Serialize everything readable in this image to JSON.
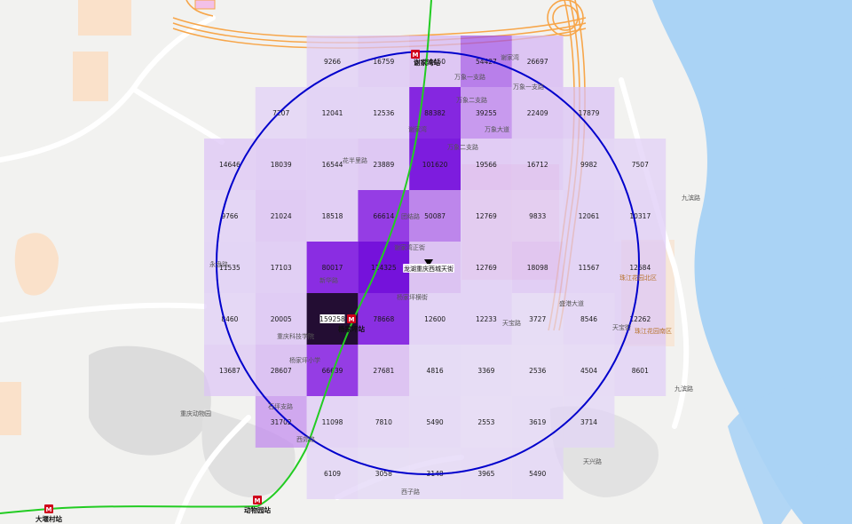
{
  "grid": {
    "rows": [
      {
        "cells": [
          null,
          null,
          9266,
          16759,
          24450,
          54427,
          26697,
          null,
          null,
          null
        ]
      },
      {
        "cells": [
          null,
          7207,
          12041,
          12536,
          88382,
          39255,
          22409,
          17879,
          null,
          null
        ]
      },
      {
        "cells": [
          14646,
          18039,
          16544,
          23889,
          101620,
          19566,
          16712,
          9982,
          7507,
          null
        ]
      },
      {
        "cells": [
          9766,
          21024,
          18518,
          66614,
          50087,
          12769,
          9833,
          12061,
          10317,
          null
        ]
      },
      {
        "cells": [
          11535,
          17103,
          80017,
          114325,
          29216,
          12769,
          18098,
          11567,
          12684,
          null
        ]
      },
      {
        "cells": [
          8460,
          20005,
          159258,
          78668,
          12600,
          12233,
          3727,
          8546,
          12262,
          null
        ]
      },
      {
        "cells": [
          13687,
          28607,
          66639,
          27681,
          4816,
          3369,
          2536,
          4504,
          8601,
          null
        ]
      },
      {
        "cells": [
          null,
          31702,
          11098,
          7810,
          5490,
          2553,
          3619,
          3714,
          null,
          null
        ]
      },
      {
        "cells": [
          null,
          null,
          6109,
          3058,
          3148,
          3965,
          5490,
          null,
          null,
          null
        ]
      }
    ],
    "colors": {
      "min": "#e3d6f7",
      "low": "#c58ef0",
      "mid": "#8a2be2",
      "high": "#6a00d8",
      "max": "#150025"
    }
  },
  "circle": {
    "color": "#0000cc"
  },
  "metro_line": {
    "color": "#22cc22"
  },
  "stations": [
    {
      "name": "谢家湾站",
      "icon": "metro-icon"
    },
    {
      "name": "杨家坪站",
      "icon": "metro-icon"
    },
    {
      "name": "动物园站",
      "icon": "metro-icon"
    },
    {
      "name": "大堰村站",
      "icon": "metro-icon"
    }
  ],
  "center": {
    "name": "龙湖重庆西城天街",
    "icon": "triangle-marker-icon"
  },
  "places": [
    "万象一支路",
    "万象一支路",
    "万象二支路",
    "万象大道",
    "万象二支路",
    "谢家湾",
    "谢家湾",
    "花半里路",
    "团结路",
    "谢家湾正街",
    "新华路",
    "杨家坪横街",
    "重庆科技学院",
    "杨家坪小学",
    "石坪支路",
    "西郊路",
    "重庆动物园",
    "天宝路",
    "盛港大道",
    "天宝街",
    "九滨路",
    "九滨路",
    "天兴路",
    "西子路",
    "珠江花园北区",
    "珠江花园南区"
  ]
}
